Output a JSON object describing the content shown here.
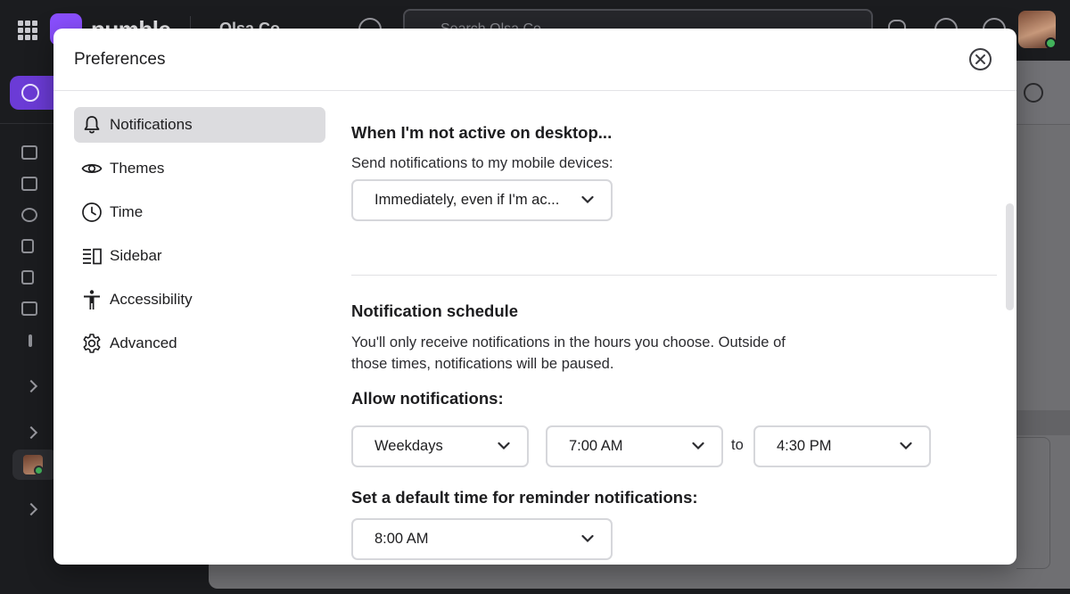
{
  "background": {
    "app_name": "pumble",
    "workspace": "Olsa Co",
    "search_placeholder": "Search Olsa Co"
  },
  "modal": {
    "title": "Preferences",
    "nav": [
      {
        "label": "Notifications",
        "icon": "bell-icon",
        "active": true
      },
      {
        "label": "Themes",
        "icon": "eye-icon",
        "active": false
      },
      {
        "label": "Time",
        "icon": "clock-icon",
        "active": false
      },
      {
        "label": "Sidebar",
        "icon": "sidebar-icon",
        "active": false
      },
      {
        "label": "Accessibility",
        "icon": "accessibility-icon",
        "active": false
      },
      {
        "label": "Advanced",
        "icon": "gear-icon",
        "active": false
      }
    ],
    "inactive": {
      "heading": "When I'm not active on desktop...",
      "label": "Send notifications to my mobile devices:",
      "select_value": "Immediately, even if I'm ac..."
    },
    "schedule": {
      "heading": "Notification schedule",
      "description_line1": "You'll only receive notifications in the hours you choose. Outside of",
      "description_line2": "those times, notifications will be paused.",
      "allow_label": "Allow notifications:",
      "days_value": "Weekdays",
      "from_value": "7:00 AM",
      "to_label": "to",
      "until_value": "4:30 PM",
      "reminder_label": "Set a default time for reminder notifications:",
      "reminder_value": "8:00 AM"
    }
  },
  "colors": {
    "accent": "#8a4fff",
    "active_nav_bg": "#dcdcdf",
    "online": "#42b35b"
  }
}
